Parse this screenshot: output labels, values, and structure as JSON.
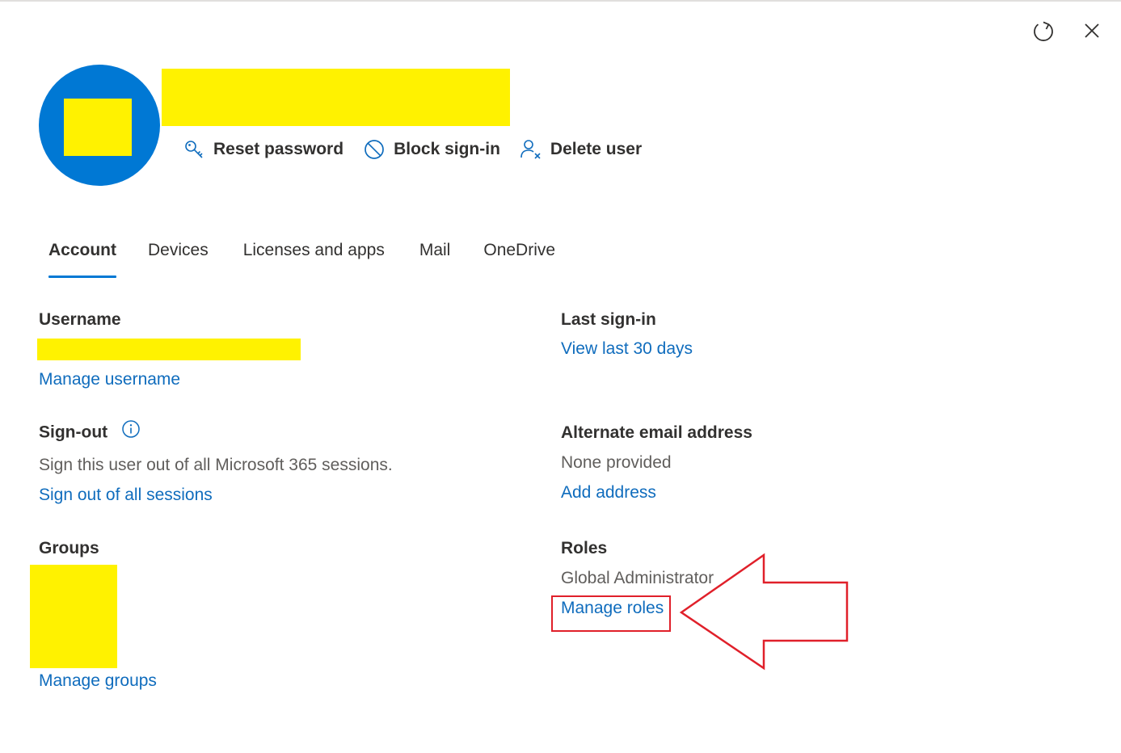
{
  "header": {
    "refresh_icon": "refresh-icon",
    "close_icon": "close-icon"
  },
  "actions": {
    "reset_password": "Reset password",
    "block_signin": "Block sign-in",
    "delete_user": "Delete user"
  },
  "tabs": [
    {
      "label": "Account",
      "active": true
    },
    {
      "label": "Devices",
      "active": false
    },
    {
      "label": "Licenses and apps",
      "active": false
    },
    {
      "label": "Mail",
      "active": false
    },
    {
      "label": "OneDrive",
      "active": false
    }
  ],
  "username": {
    "label": "Username",
    "link": "Manage username"
  },
  "last_signin": {
    "label": "Last sign-in",
    "link": "View last 30 days"
  },
  "signout": {
    "label": "Sign-out",
    "description": "Sign this user out of all Microsoft 365 sessions.",
    "link": "Sign out of all sessions"
  },
  "alternate_email": {
    "label": "Alternate email address",
    "value": "None provided",
    "link": "Add address"
  },
  "groups": {
    "label": "Groups",
    "link": "Manage groups"
  },
  "roles": {
    "label": "Roles",
    "value": "Global Administrator",
    "link": "Manage roles"
  },
  "colors": {
    "accent": "#0078d4",
    "link": "#0f6cbd",
    "redaction": "#fff200",
    "annotation": "#e0202a"
  }
}
